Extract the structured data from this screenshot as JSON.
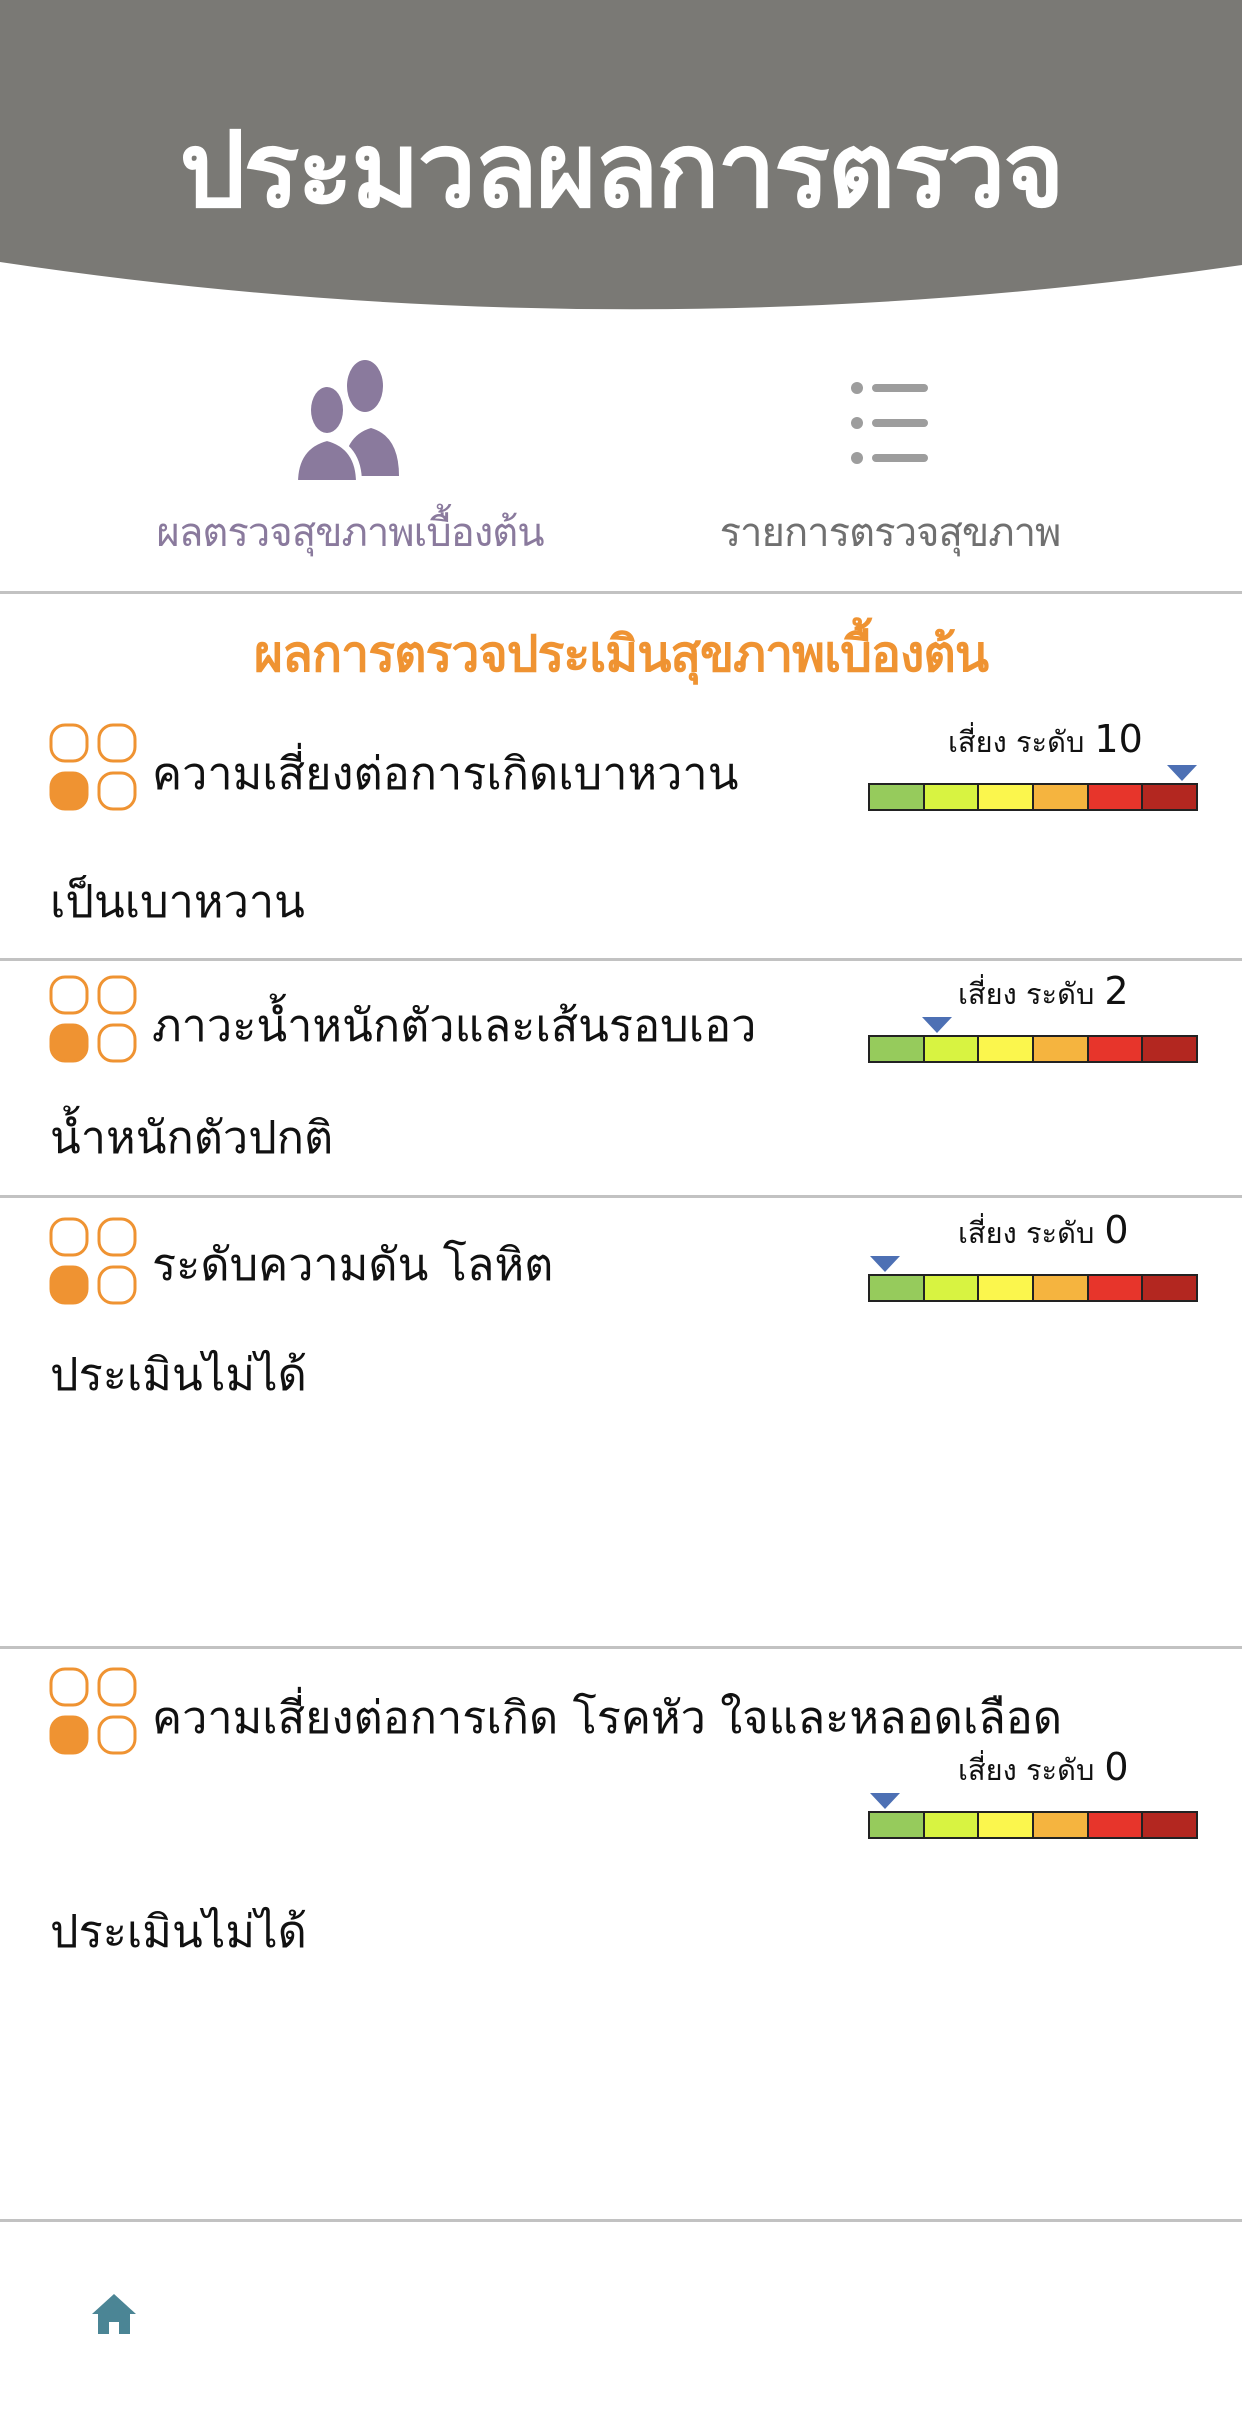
{
  "header": {
    "title": "ประมวลผลการตรวจ"
  },
  "tabs": {
    "basic": {
      "label": "ผลตรวจสุขภาพเบื้องต้น",
      "icon": "people-icon"
    },
    "list": {
      "label": "รายการตรวจสุขภาพ",
      "icon": "list-icon"
    }
  },
  "section_title": "ผลการตรวจประเมินสุขภาพเบื้องต้น",
  "risk_label": "เสี่ยง ระดับ",
  "meter_colors": [
    "#96cb5c",
    "#d8f341",
    "#fbf64d",
    "#f5b43f",
    "#e7352b",
    "#b32720"
  ],
  "marker_color": "#4d70b4",
  "accent_color": "#ef9332",
  "cards": [
    {
      "title": "ความเสี่ยงต่อการเกิดเบาหวาน",
      "risk_level": "10",
      "level_fraction": 0.95,
      "result": "เป็นเบาหวาน"
    },
    {
      "title": "ภาวะน้ำหนักตัวและเส้นรอบเอว",
      "risk_level": "2",
      "level_fraction": 0.21,
      "result": "น้ำหนักตัวปกติ"
    },
    {
      "title": "ระดับความดัน โลหิต",
      "risk_level": "0",
      "level_fraction": 0.05,
      "result": "ประเมินไม่ได้"
    },
    {
      "title": "ความเสี่ยงต่อการเกิด โรคหัว ใจและหลอดเลือด",
      "risk_level": "0",
      "level_fraction": 0.05,
      "result": "ประเมินไม่ได้"
    }
  ],
  "footer": {
    "home_icon": "home-icon"
  }
}
